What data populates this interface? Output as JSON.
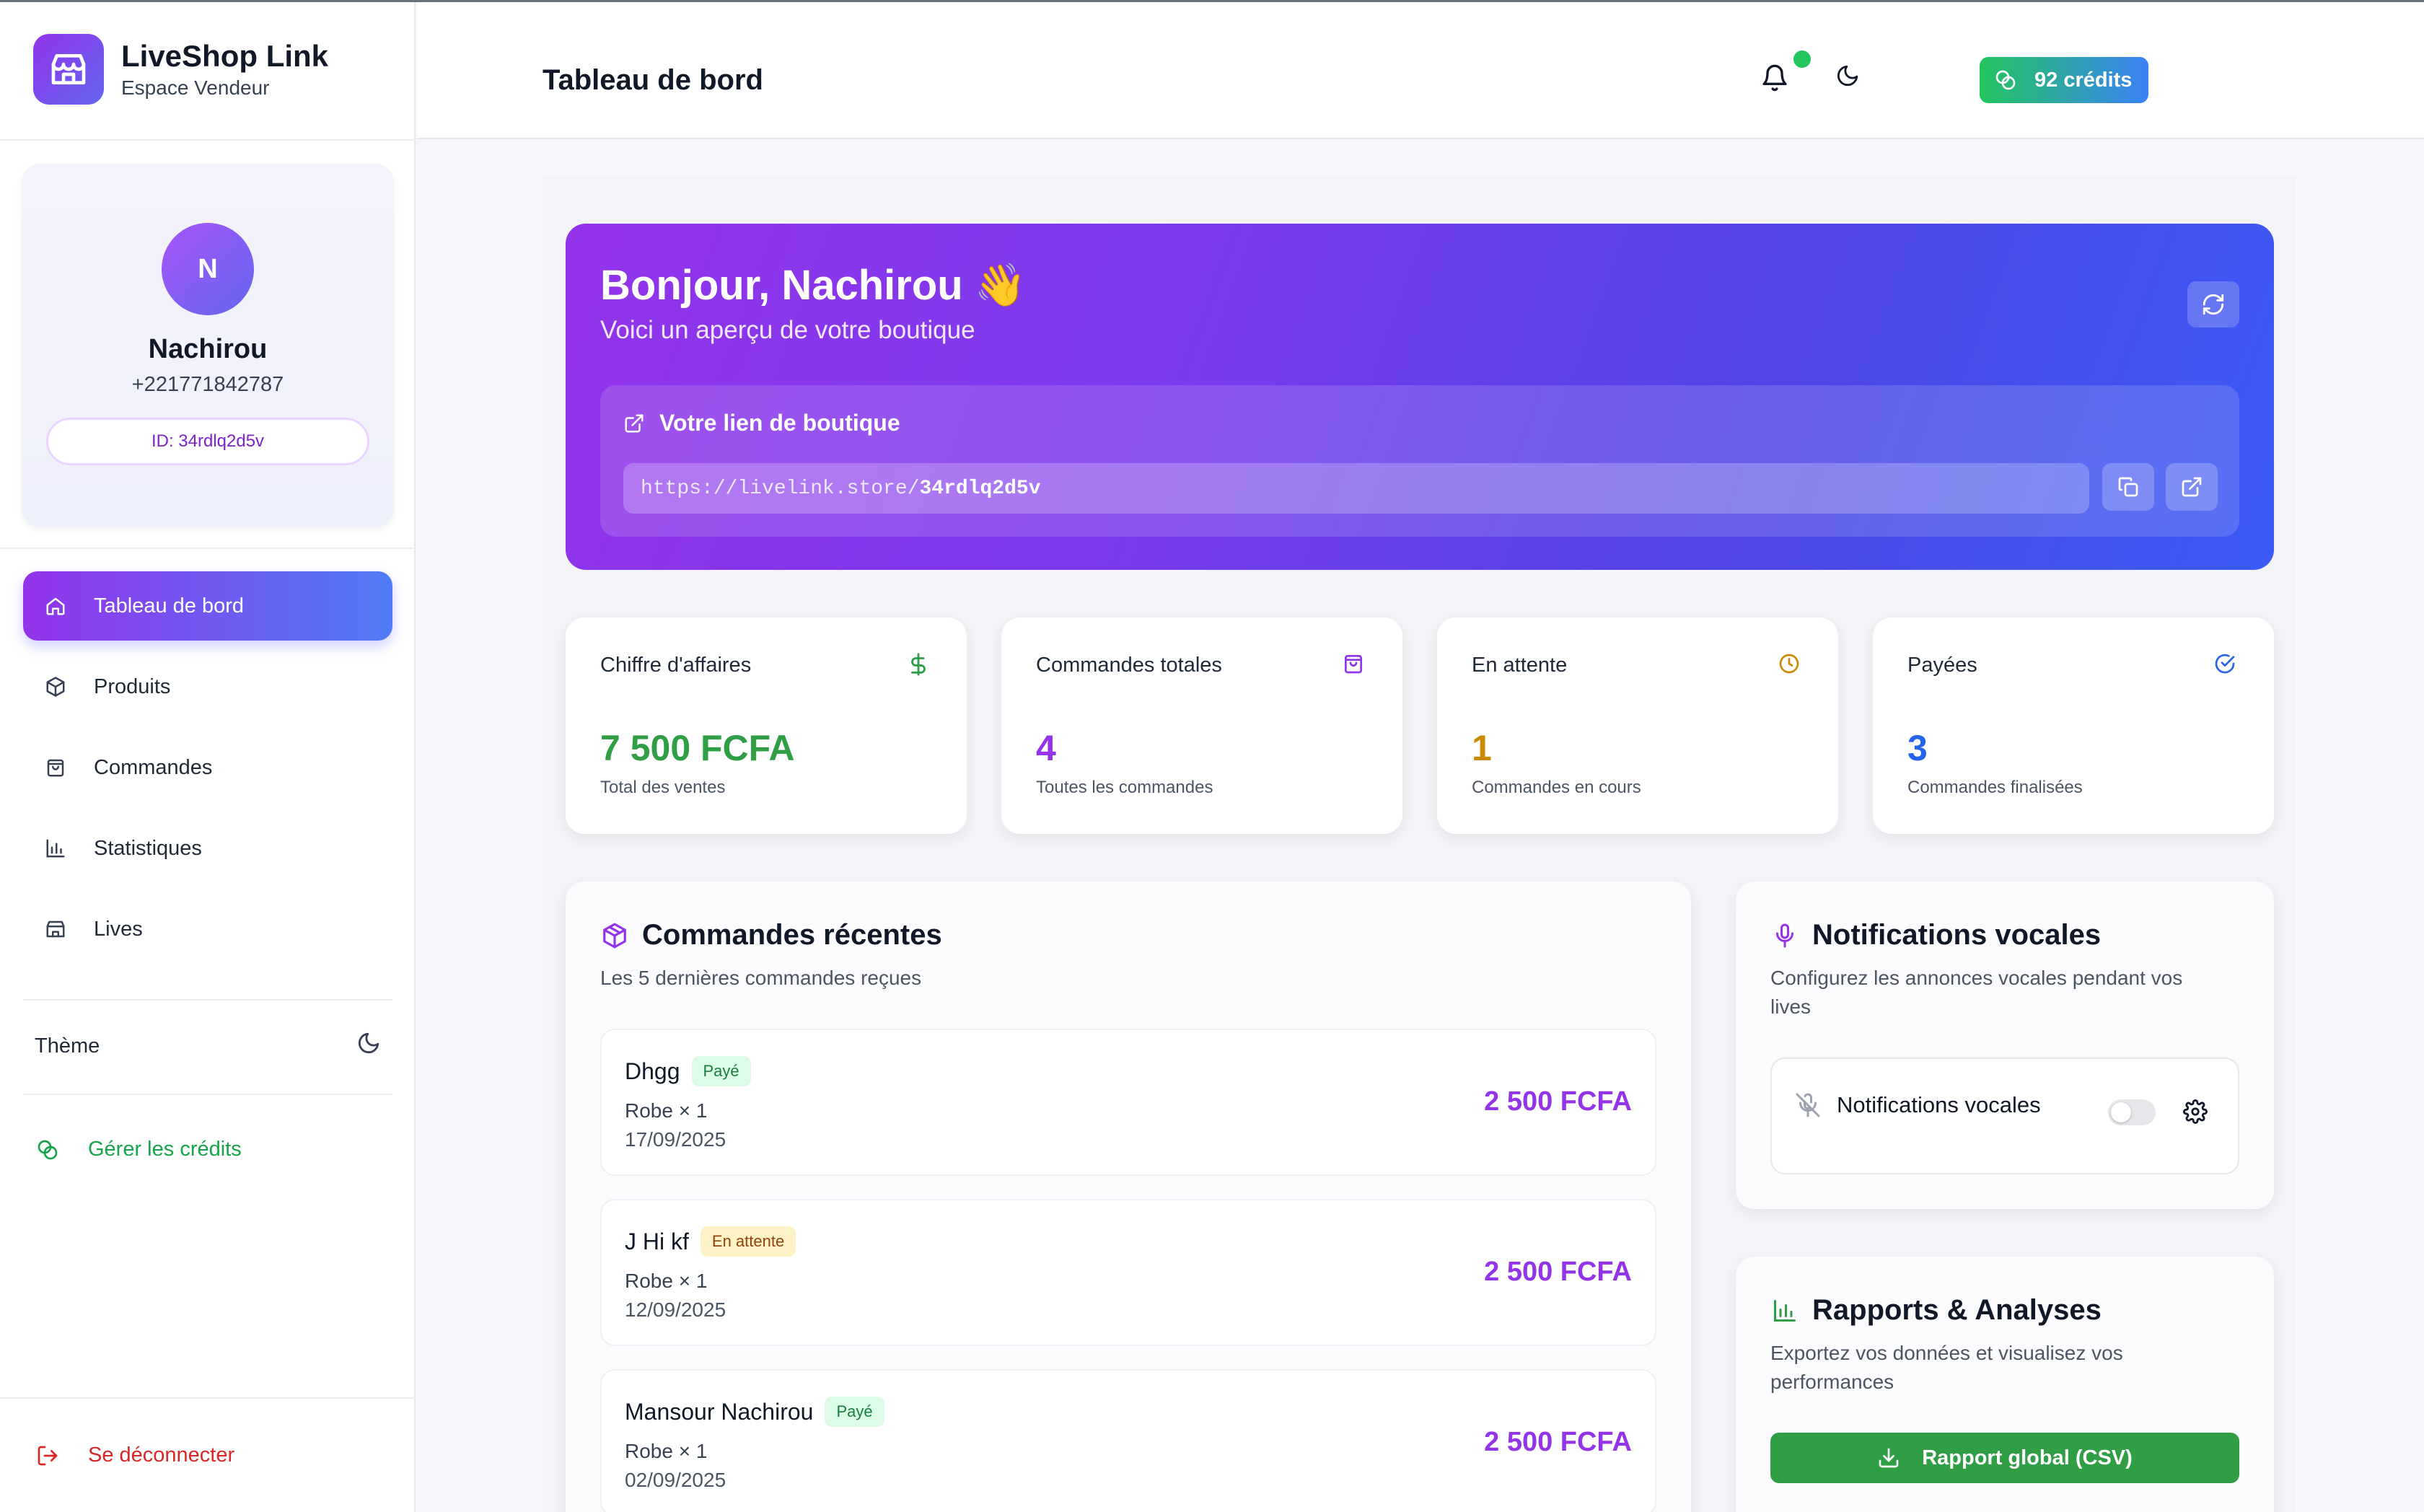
{
  "app": {
    "name": "LiveShop Link",
    "subtitle": "Espace Vendeur"
  },
  "profile": {
    "initial": "N",
    "name": "Nachirou",
    "phone": "+221771842787",
    "id_label": "ID: 34rdlq2d5v"
  },
  "sidebar": {
    "items": [
      {
        "label": "Tableau de bord",
        "icon": "home-icon",
        "active": true
      },
      {
        "label": "Produits",
        "icon": "box-icon"
      },
      {
        "label": "Commandes",
        "icon": "shopping-bag-icon"
      },
      {
        "label": "Statistiques",
        "icon": "bar-chart-icon"
      },
      {
        "label": "Lives",
        "icon": "store-icon"
      }
    ],
    "theme_label": "Thème",
    "credits_label": "Gérer les crédits",
    "logout_label": "Se déconnecter"
  },
  "header": {
    "title": "Tableau de bord",
    "credits": "92 crédits"
  },
  "hero": {
    "greeting": "Bonjour, Nachirou 👋",
    "subtitle": "Voici un aperçu de votre boutique",
    "link_title": "Votre lien de boutique",
    "url_prefix": "https://livelink.store/",
    "url_slug": "34rdlq2d5v"
  },
  "stats": [
    {
      "label": "Chiffre d'affaires",
      "value": "7 500 FCFA",
      "sub": "Total des ventes",
      "color": "#2f9e44",
      "icon": "dollar-icon"
    },
    {
      "label": "Commandes totales",
      "value": "4",
      "sub": "Toutes les commandes",
      "color": "#9333ea",
      "icon": "shopping-bag-icon"
    },
    {
      "label": "En attente",
      "value": "1",
      "sub": "Commandes en cours",
      "color": "#ca8a04",
      "icon": "clock-icon"
    },
    {
      "label": "Payées",
      "value": "3",
      "sub": "Commandes finalisées",
      "color": "#2563eb",
      "icon": "check-circle-icon"
    }
  ],
  "recent_orders": {
    "title": "Commandes récentes",
    "subtitle": "Les 5 dernières commandes reçues",
    "orders": [
      {
        "name": "Dhgg",
        "status": "Payé",
        "line": "Robe × 1",
        "date": "17/09/2025",
        "amount": "2 500 FCFA"
      },
      {
        "name": "J Hi kf",
        "status": "En attente",
        "line": "Robe × 1",
        "date": "12/09/2025",
        "amount": "2 500 FCFA"
      },
      {
        "name": "Mansour Nachirou",
        "status": "Payé",
        "line": "Robe × 1",
        "date": "02/09/2025",
        "amount": "2 500 FCFA"
      }
    ]
  },
  "voice": {
    "title": "Notifications vocales",
    "subtitle_l1": "Configurez les annonces vocales pendant vos",
    "subtitle_l2": "lives",
    "toggle_label": "Notifications vocales",
    "enabled": false
  },
  "reports": {
    "title": "Rapports & Analyses",
    "subtitle_l1": "Exportez vos données et visualisez vos",
    "subtitle_l2": "performances",
    "export_label": "Rapport global (CSV)"
  }
}
